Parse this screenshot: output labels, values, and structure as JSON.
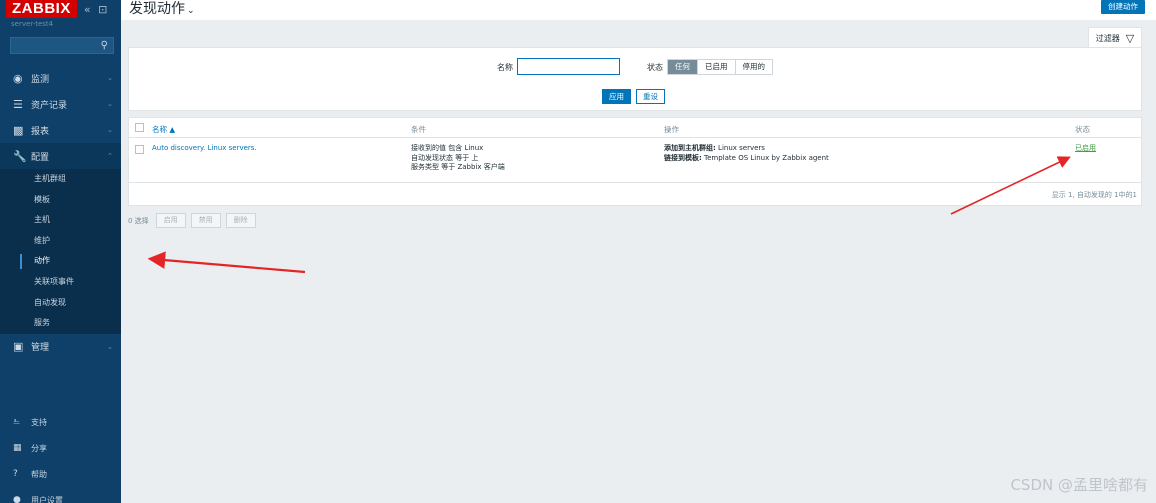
{
  "sidebar": {
    "logo": "ZABBIX",
    "collapse_controls": "«  ⊡",
    "server_name": "server-test4",
    "search_icon": "search-icon",
    "menu": [
      {
        "label": "监测",
        "icon": "eye-icon"
      },
      {
        "label": "资产记录",
        "icon": "list-icon"
      },
      {
        "label": "报表",
        "icon": "bar-chart-icon"
      },
      {
        "label": "配置",
        "icon": "wrench-icon"
      }
    ],
    "config_sub": [
      "主机群组",
      "模板",
      "主机",
      "维护",
      "动作",
      "关联项事件",
      "自动发现",
      "服务"
    ],
    "admin": {
      "label": "管理",
      "icon": "admin-icon"
    },
    "bottom": [
      {
        "label": "支持",
        "icon": "support-icon"
      },
      {
        "label": "分享",
        "icon": "share-icon"
      },
      {
        "label": "帮助",
        "icon": "help-icon"
      },
      {
        "label": "用户设置",
        "icon": "user-icon"
      }
    ]
  },
  "header": {
    "title": "发现动作",
    "create_button": "创建动作"
  },
  "filter": {
    "tab_label": "过滤器",
    "name_label": "名称",
    "name_value": "",
    "status_label": "状态",
    "status_options": [
      "任何",
      "已启用",
      "停用的"
    ],
    "status_selected": "任何",
    "apply": "应用",
    "reset": "重设"
  },
  "table": {
    "columns": [
      "名称 ▲",
      "条件",
      "操作",
      "状态"
    ],
    "rows": [
      {
        "name": "Auto discovery. Linux servers.",
        "conditions": [
          "接收到的值 包含 Linux",
          "自动发现状态 等于 上",
          "服务类型 等于 Zabbix 客户端"
        ],
        "operations": [
          {
            "bold": "添加到主机群组:",
            "text": " Linux servers"
          },
          {
            "bold": "链接到模板:",
            "text": " Template OS Linux by Zabbix agent"
          }
        ],
        "status": "已启用"
      }
    ],
    "summary": "显示 1, 自动发现的 1中的1"
  },
  "mass_actions": {
    "selected_count": "0 选择",
    "buttons": [
      "启用",
      "禁用",
      "删除"
    ]
  },
  "watermark": "CSDN @孟里啥都有"
}
